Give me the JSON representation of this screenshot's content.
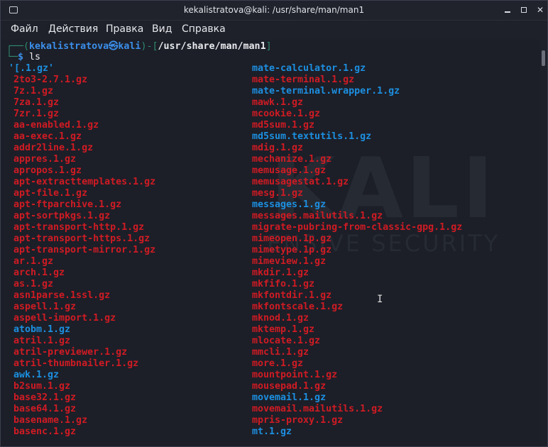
{
  "window": {
    "title": "kekalistratova@kali: /usr/share/man/man1",
    "buttons": {
      "minimize": "minimize",
      "maximize": "maximize",
      "close": "close"
    }
  },
  "menu": [
    {
      "label": "Файл"
    },
    {
      "label": "Действия"
    },
    {
      "label": "Правка"
    },
    {
      "label": "Вид"
    },
    {
      "label": "Справка"
    }
  ],
  "prompt": {
    "open": "┌──(",
    "user": "kekalistratova",
    "at": "㉿",
    "host": "kali",
    "mid": ")-[",
    "path": "/usr/share/man/man1",
    "close": "]",
    "line2": "└─",
    "dollar": "$",
    "command": " ls"
  },
  "colors": {
    "executable_red": "#d01b24",
    "link_blue": "#1c8fe0",
    "prompt_blue": "#3b8eea",
    "frame_green": "#2f8b6f"
  },
  "listing": {
    "col1": [
      {
        "name": "'[.1.gz'",
        "color": "blue"
      },
      {
        "name": "2to3-2.7.1.gz",
        "color": "red"
      },
      {
        "name": "7z.1.gz",
        "color": "red"
      },
      {
        "name": "7za.1.gz",
        "color": "red"
      },
      {
        "name": "7zr.1.gz",
        "color": "red"
      },
      {
        "name": "aa-enabled.1.gz",
        "color": "red"
      },
      {
        "name": "aa-exec.1.gz",
        "color": "red"
      },
      {
        "name": "addr2line.1.gz",
        "color": "red"
      },
      {
        "name": "appres.1.gz",
        "color": "red"
      },
      {
        "name": "apropos.1.gz",
        "color": "red"
      },
      {
        "name": "apt-extracttemplates.1.gz",
        "color": "red"
      },
      {
        "name": "apt-file.1.gz",
        "color": "red"
      },
      {
        "name": "apt-ftparchive.1.gz",
        "color": "red"
      },
      {
        "name": "apt-sortpkgs.1.gz",
        "color": "red"
      },
      {
        "name": "apt-transport-http.1.gz",
        "color": "red"
      },
      {
        "name": "apt-transport-https.1.gz",
        "color": "red"
      },
      {
        "name": "apt-transport-mirror.1.gz",
        "color": "red"
      },
      {
        "name": "ar.1.gz",
        "color": "red"
      },
      {
        "name": "arch.1.gz",
        "color": "red"
      },
      {
        "name": "as.1.gz",
        "color": "red"
      },
      {
        "name": "asn1parse.1ssl.gz",
        "color": "red"
      },
      {
        "name": "aspell.1.gz",
        "color": "red"
      },
      {
        "name": "aspell-import.1.gz",
        "color": "red"
      },
      {
        "name": "atobm.1.gz",
        "color": "blue"
      },
      {
        "name": "atril.1.gz",
        "color": "red"
      },
      {
        "name": "atril-previewer.1.gz",
        "color": "red"
      },
      {
        "name": "atril-thumbnailer.1.gz",
        "color": "red"
      },
      {
        "name": "awk.1.gz",
        "color": "blue"
      },
      {
        "name": "b2sum.1.gz",
        "color": "red"
      },
      {
        "name": "base32.1.gz",
        "color": "red"
      },
      {
        "name": "base64.1.gz",
        "color": "red"
      },
      {
        "name": "basename.1.gz",
        "color": "red"
      },
      {
        "name": "basenc.1.gz",
        "color": "red"
      }
    ],
    "col2": [
      {
        "name": "mate-calculator.1.gz",
        "color": "blue"
      },
      {
        "name": "mate-terminal.1.gz",
        "color": "red"
      },
      {
        "name": "mate-terminal.wrapper.1.gz",
        "color": "blue"
      },
      {
        "name": "mawk.1.gz",
        "color": "red"
      },
      {
        "name": "mcookie.1.gz",
        "color": "red"
      },
      {
        "name": "md5sum.1.gz",
        "color": "red"
      },
      {
        "name": "md5sum.textutils.1.gz",
        "color": "blue"
      },
      {
        "name": "mdig.1.gz",
        "color": "red"
      },
      {
        "name": "mechanize.1.gz",
        "color": "red"
      },
      {
        "name": "memusage.1.gz",
        "color": "red"
      },
      {
        "name": "memusagestat.1.gz",
        "color": "red"
      },
      {
        "name": "mesg.1.gz",
        "color": "red"
      },
      {
        "name": "messages.1.gz",
        "color": "blue"
      },
      {
        "name": "messages.mailutils.1.gz",
        "color": "red"
      },
      {
        "name": "migrate-pubring-from-classic-gpg.1.gz",
        "color": "red"
      },
      {
        "name": "mimeopen.1p.gz",
        "color": "red"
      },
      {
        "name": "mimetype.1p.gz",
        "color": "red"
      },
      {
        "name": "mimeview.1.gz",
        "color": "red"
      },
      {
        "name": "mkdir.1.gz",
        "color": "red"
      },
      {
        "name": "mkfifo.1.gz",
        "color": "red"
      },
      {
        "name": "mkfontdir.1.gz",
        "color": "red"
      },
      {
        "name": "mkfontscale.1.gz",
        "color": "red"
      },
      {
        "name": "mknod.1.gz",
        "color": "red"
      },
      {
        "name": "mktemp.1.gz",
        "color": "red"
      },
      {
        "name": "mlocate.1.gz",
        "color": "red"
      },
      {
        "name": "mmcli.1.gz",
        "color": "red"
      },
      {
        "name": "more.1.gz",
        "color": "red"
      },
      {
        "name": "mountpoint.1.gz",
        "color": "red"
      },
      {
        "name": "mousepad.1.gz",
        "color": "red"
      },
      {
        "name": "movemail.1.gz",
        "color": "blue"
      },
      {
        "name": "movemail.mailutils.1.gz",
        "color": "red"
      },
      {
        "name": "mpris-proxy.1.gz",
        "color": "red"
      },
      {
        "name": "mt.1.gz",
        "color": "blue"
      }
    ]
  },
  "watermark": {
    "logo_text": "KALI",
    "tagline": "ENSIVE SECURITY"
  }
}
